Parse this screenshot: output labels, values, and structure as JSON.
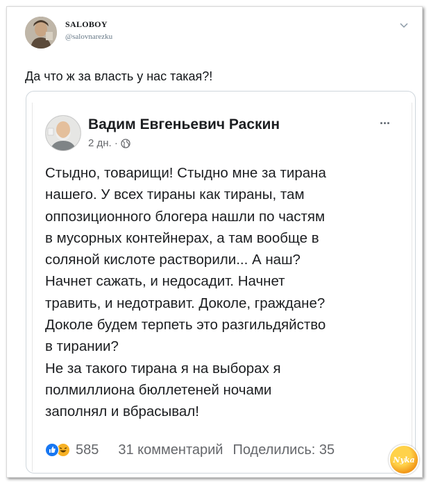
{
  "tweet": {
    "author_name": "SALOBOY",
    "author_handle": "@salovnarezku",
    "text": "Да что ж за власть у нас такая?!",
    "chevron_icon": "chevron-down-icon"
  },
  "quoted_post": {
    "author_name": "Вадим Евгеньевич Раскин",
    "time": "2 дн. ·",
    "privacy_icon": "globe-icon",
    "more_icon": "more-dots-icon",
    "more_label": "···",
    "body_lines": [
      "Стыдно, товарищи! Стыдно мне за тирана",
      "нашего. У всех тираны как тираны, там",
      "оппозиционного блогера нашли по частям",
      "в мусорных контейнерах,  а там вообще в",
      "соляной кислоте растворили... А наш?",
      "Начнет сажать, и недосадит. Начнет",
      "травить, и недотравит. Доколе, граждане?",
      "Доколе будем терпеть это разгильдяйство",
      "в тирании?",
      "Не за такого тирана я на выборах я",
      "полмиллиона бюллетеней ночами",
      "заполнял и вбрасывал!"
    ],
    "reactions_count": "585",
    "comments": "31 комментарий",
    "shares": "Поделились: 35"
  },
  "watermark": {
    "text": "Nyka"
  },
  "colors": {
    "like_blue": "#1877f2",
    "haha_yellow": "#f7b125",
    "text_dark": "#1c1e21",
    "text_muted": "#65676b"
  }
}
